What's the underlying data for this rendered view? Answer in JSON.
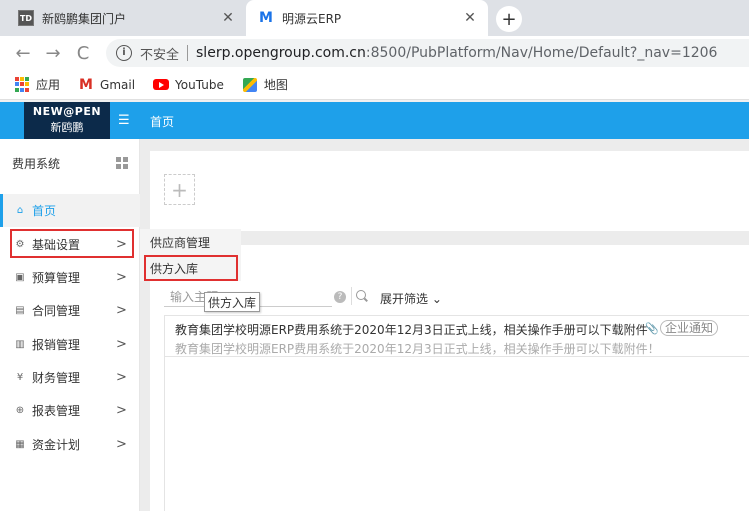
{
  "browser": {
    "tabs": [
      {
        "favicon": "TD",
        "title": "新鸥鹏集团门户"
      },
      {
        "favicon": "M",
        "title": "明源云ERP"
      }
    ],
    "tab_close": "✕",
    "new_tab": "+",
    "nav": {
      "back": "←",
      "forward": "→",
      "reload": "C"
    },
    "security_label": "不安全",
    "url_host": "slerp.opengroup.com.cn",
    "url_rest": ":8500/PubPlatform/Nav/Home/Default?_nav=1206",
    "bookmarks": [
      {
        "icon": "apps-grid-icon",
        "label": "应用"
      },
      {
        "icon": "gmail-icon",
        "label": "Gmail"
      },
      {
        "icon": "youtube-icon",
        "label": "YouTube"
      },
      {
        "icon": "maps-icon",
        "label": "地图"
      }
    ]
  },
  "app": {
    "logo_line1": "NEW@PEN",
    "logo_line2": "新鸥鹏",
    "header_title": "首页",
    "accent_color": "#1ea0ea",
    "system_title": "费用系统",
    "sidebar": [
      {
        "icon": "home-icon",
        "glyph": "⌂",
        "label": "首页"
      },
      {
        "icon": "gear-icon",
        "glyph": "⚙",
        "label": "基础设置"
      },
      {
        "icon": "budget-icon",
        "glyph": "▣",
        "label": "预算管理"
      },
      {
        "icon": "contract-icon",
        "glyph": "▤",
        "label": "合同管理"
      },
      {
        "icon": "reimburse-icon",
        "glyph": "▥",
        "label": "报销管理"
      },
      {
        "icon": "finance-icon",
        "glyph": "¥",
        "label": "财务管理"
      },
      {
        "icon": "report-icon",
        "glyph": "⊕",
        "label": "报表管理"
      },
      {
        "icon": "fund-icon",
        "glyph": "▦",
        "label": "资金计划"
      }
    ],
    "chevron": ">",
    "flyout": [
      "供应商管理",
      "供方入库"
    ],
    "tooltip": "供方入库",
    "search_placeholder": "输入主题",
    "help_glyph": "?",
    "filter_label": "展开筛选",
    "notice": {
      "title": "教育集团学校明源ERP费用系统于2020年12月3日正式上线，相关操作手册可以下载附件",
      "tag": "企业通知",
      "subtitle": "教育集团学校明源ERP费用系统于2020年12月3日正式上线，相关操作手册可以下载附件！"
    }
  }
}
